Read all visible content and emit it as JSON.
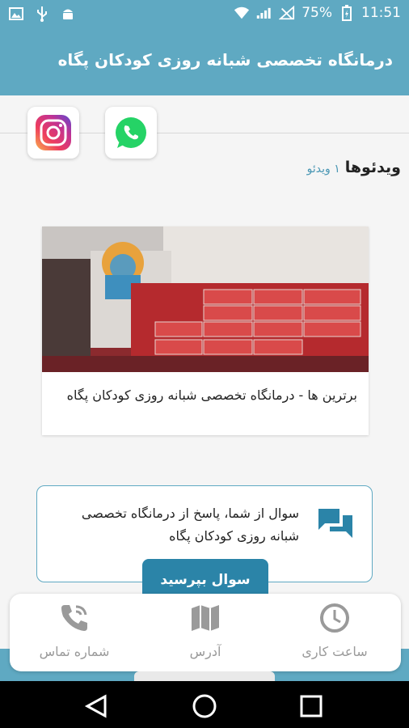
{
  "status_bar": {
    "battery_percent": "75%",
    "time": "11:51",
    "icons": [
      "image-icon",
      "usb-icon",
      "android-icon",
      "wifi-icon",
      "signal-icon",
      "no-signal-icon",
      "battery-charging-icon"
    ]
  },
  "app_bar": {
    "title": "درمانگاه تخصصی شبانه روزی کودکان پگاه"
  },
  "social": {
    "items": [
      "instagram-icon",
      "whatsapp-icon"
    ]
  },
  "videos": {
    "title": "ویدئوها",
    "count": "۱ ویدئو",
    "items": [
      {
        "title": "برترین ها - درمانگاه تخصصی شبانه روزی کودکان پگاه"
      }
    ]
  },
  "qa": {
    "text": "سوال از شما، پاسخ از درمانگاه تخصصی شبانه روزی کودکان پگاه",
    "button_label": "سوال بپرسید"
  },
  "bottom_nav": {
    "items": [
      {
        "label": "شماره تماس",
        "icon": "phone-call-icon"
      },
      {
        "label": "آدرس",
        "icon": "map-icon"
      },
      {
        "label": "ساعت کاری",
        "icon": "clock-icon"
      }
    ]
  },
  "colors": {
    "primary": "#5fa9c2",
    "button": "#2b84a8",
    "nav_icon": "#9a9a9a",
    "qa_icon": "#2b84a8"
  }
}
